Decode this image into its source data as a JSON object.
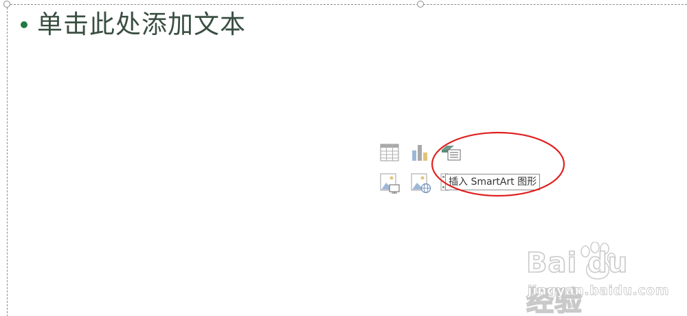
{
  "slide": {
    "bullet_text": "单击此处添加文本"
  },
  "content_icons": [
    {
      "name": "table-icon",
      "label": "表格"
    },
    {
      "name": "chart-icon",
      "label": "图表"
    },
    {
      "name": "smartart-icon",
      "label": "SmartArt"
    },
    {
      "name": "picture-icon",
      "label": "图片"
    },
    {
      "name": "online-picture-icon",
      "label": "联机图片"
    },
    {
      "name": "video-icon",
      "label": "视频"
    }
  ],
  "tooltip": {
    "text": "插入 SmartArt 图形"
  },
  "watermark": {
    "brand": "Bai du 经验",
    "url": "jingyan.baidu.com"
  },
  "colors": {
    "bullet": "#1f7a43",
    "text": "#3a4f42",
    "annotation": "#e02020",
    "frame": "#8a8a8a"
  }
}
